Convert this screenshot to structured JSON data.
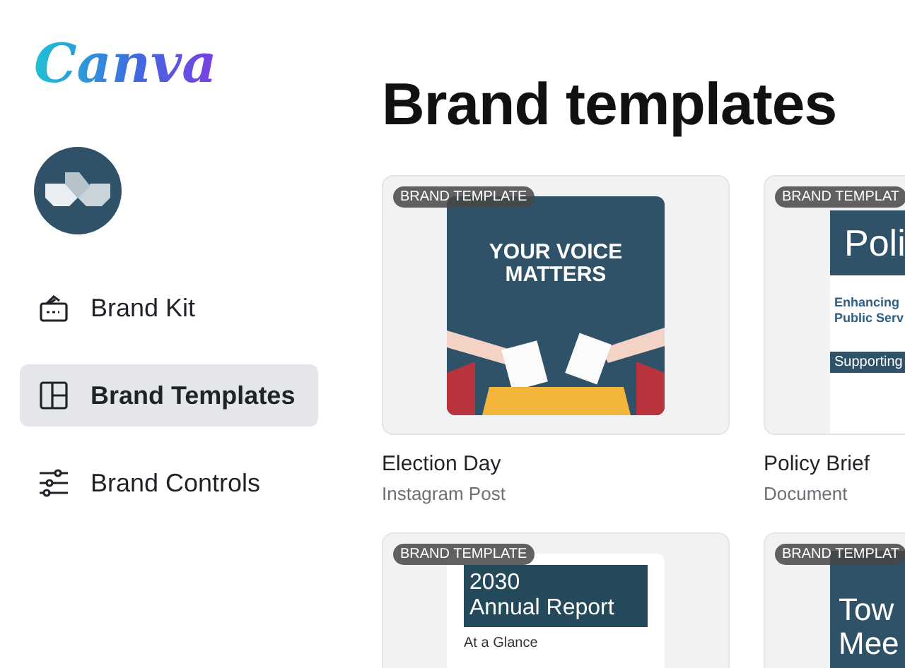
{
  "logo": "Canva",
  "sidebar": {
    "items": [
      {
        "label": "Brand Kit",
        "selected": false
      },
      {
        "label": "Brand Templates",
        "selected": true
      },
      {
        "label": "Brand Controls",
        "selected": false
      }
    ]
  },
  "page_title": "Brand templates",
  "templates": [
    {
      "badge": "BRAND TEMPLATE",
      "name": "Election Day",
      "type": "Instagram Post",
      "preview": {
        "kind": "poster",
        "lines": [
          "YOUR VOICE",
          "MATTERS"
        ]
      }
    },
    {
      "badge": "BRAND TEMPLAT",
      "name": "Policy Brief",
      "type": "Document",
      "preview": {
        "kind": "document",
        "lines": [
          "Poli",
          "Enhancing",
          "Public Serv",
          "Supporting"
        ]
      }
    },
    {
      "badge": "BRAND TEMPLATE",
      "preview": {
        "kind": "report",
        "lines": [
          "2030",
          "Annual Report",
          "At a Glance"
        ]
      }
    },
    {
      "badge": "BRAND TEMPLAT",
      "preview": {
        "kind": "flyer",
        "lines": [
          "Tow",
          "Mee"
        ]
      }
    }
  ]
}
